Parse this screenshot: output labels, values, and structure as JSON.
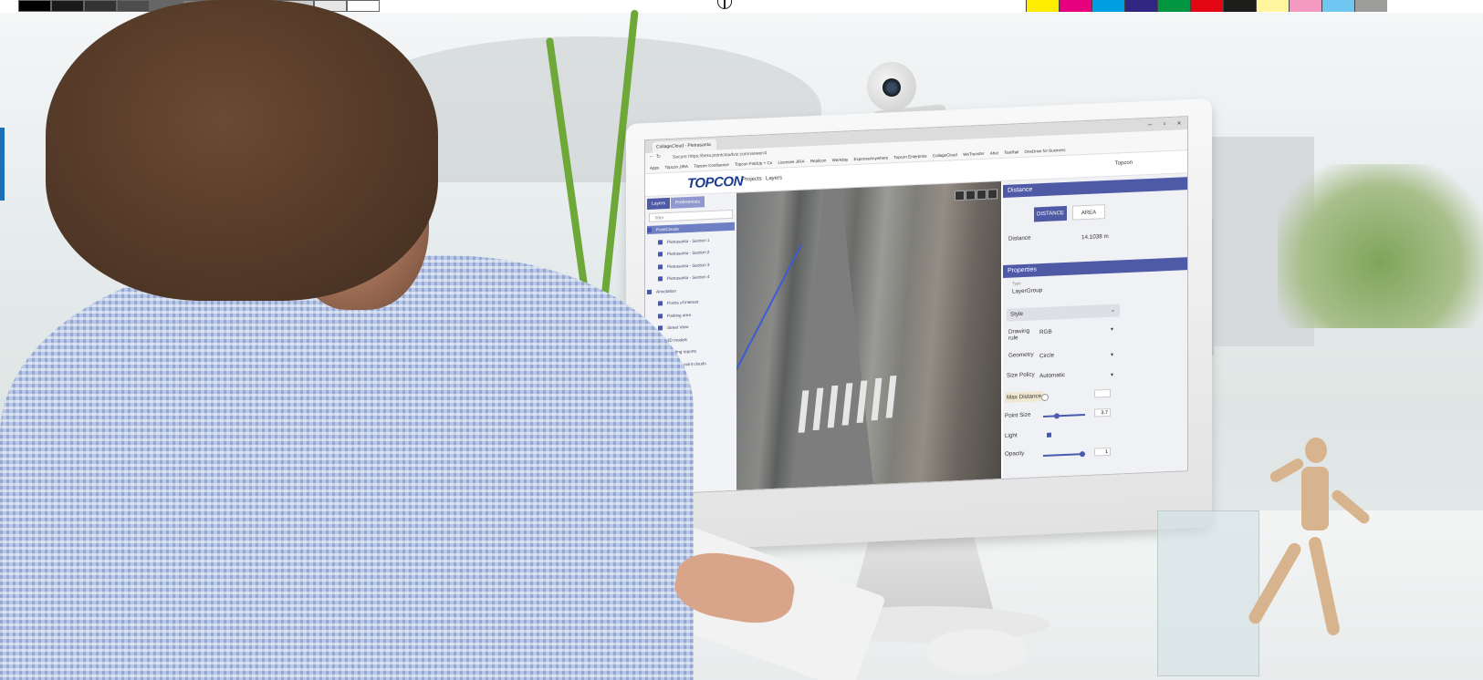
{
  "colors": {
    "gray_patches": [
      "#000000",
      "#1a1a1a",
      "#333333",
      "#4d4d4d",
      "#666666",
      "#808080",
      "#999999",
      "#b3b3b3",
      "#cccccc",
      "#e6e6e6",
      "#ffffff"
    ],
    "color_patches": [
      "#ffed00",
      "#e6007e",
      "#009fe3",
      "#312783",
      "#009640",
      "#e30613",
      "#1d1d1b",
      "#fff59d",
      "#f49ac1",
      "#6ec6f1",
      "#9d9d9c"
    ],
    "accent": "#4e5aa6"
  },
  "browser": {
    "tab_title": "CollageCloud - Pietrasanta",
    "address": "Secure  https://beta.pointcloudviz.com/viewer/4",
    "window_buttons": [
      "–",
      "▫",
      "×"
    ],
    "bookmarks": [
      "Apps",
      "Topcon JIRA",
      "Topcon Confluence",
      "Topcon FoldUp + Co",
      "Licensee JIRA",
      "Replicon",
      "Workday",
      "ExpenseAnywhere",
      "Topcon Enterprise",
      "CollageCloud",
      "WeTransfer",
      "Aha!",
      "TestRail",
      "OneDrive for Business"
    ]
  },
  "app": {
    "logo": "TOPCON",
    "nav": [
      "Projects",
      "Layers"
    ],
    "user": "Topcon"
  },
  "left_panel": {
    "tabs": [
      "Layers",
      "Preferences"
    ],
    "filter_placeholder": "filter",
    "tree": [
      {
        "label": "PointClouds",
        "level": 0,
        "selected": true
      },
      {
        "label": "Pietrasanta - Section 1",
        "level": 1
      },
      {
        "label": "Pietrasanta - Section 2",
        "level": 1
      },
      {
        "label": "Pietrasanta - Section 3",
        "level": 1
      },
      {
        "label": "Pietrasanta - Section 4",
        "level": 1
      },
      {
        "label": "Annotation",
        "level": 0
      },
      {
        "label": "Points of interest",
        "level": 1
      },
      {
        "label": "Parking area",
        "level": 1
      },
      {
        "label": "Street View",
        "level": 1
      },
      {
        "label": "3D models",
        "level": 1
      },
      {
        "label": "Building reports",
        "level": 1
      },
      {
        "label": "External point clouds",
        "level": 1
      }
    ]
  },
  "right_panel": {
    "distance_title": "Distance",
    "distance_btn": "DISTANCE",
    "area_btn": "AREA",
    "distance_label": "Distance",
    "distance_value": "14.1038 m",
    "properties_title": "Properties",
    "type_label": "Type",
    "type_value": "LayerGroup",
    "style_label": "Style",
    "drawing_rule_label": "Drawing rule",
    "drawing_rule_value": "RGB",
    "geometry_label": "Geometry",
    "geometry_value": "Circle",
    "size_policy_label": "Size Policy",
    "size_policy_value": "Automatic",
    "max_distance_label": "Max Distance",
    "point_size_label": "Point Size",
    "point_size_value": "3.7",
    "light_label": "Light",
    "opacity_label": "Opacity",
    "opacity_value": "1"
  }
}
